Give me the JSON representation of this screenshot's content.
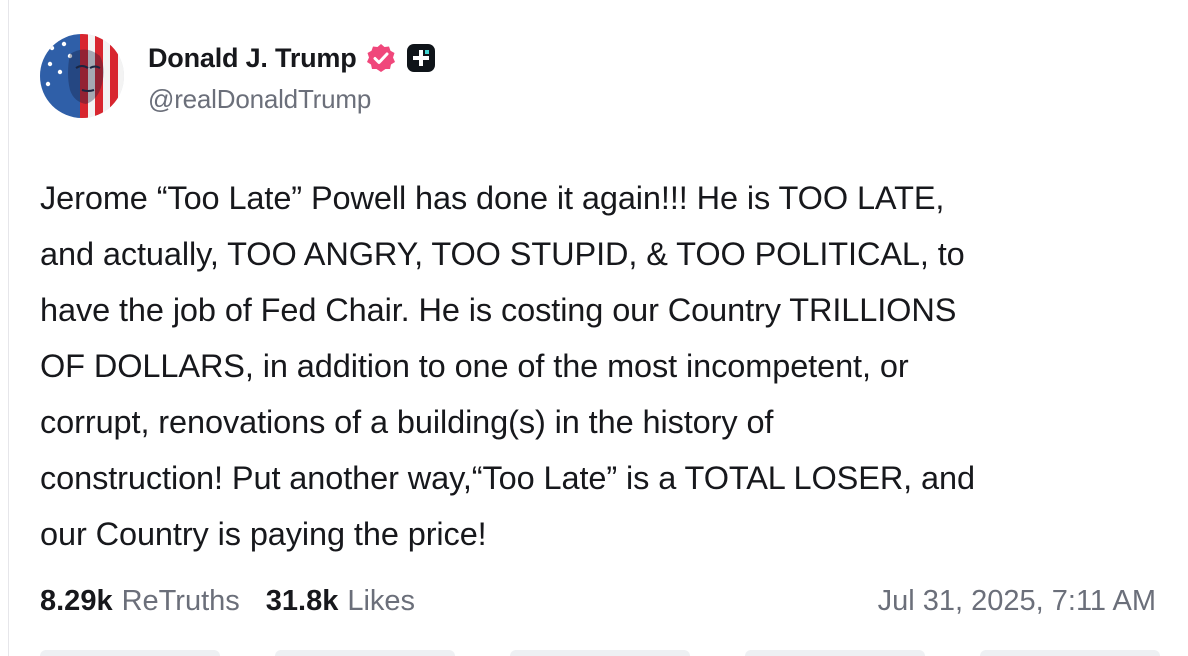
{
  "post": {
    "author": {
      "display_name": "Donald J. Trump",
      "handle": "@realDonaldTrump",
      "verified_icon": "verified-badge-icon",
      "plus_icon": "truth-plus-icon"
    },
    "text": "Jerome “Too Late” Powell has done it again!!! He is TOO LATE,\nand actually, TOO ANGRY, TOO STUPID, & TOO POLITICAL, to\nhave the job of Fed Chair. He is costing our Country TRILLIONS\nOF DOLLARS, in addition to one of the most incompetent, or\ncorrupt, renovations of a building(s) in the history of\nconstruction! Put another way,“Too Late” is a TOTAL LOSER, and\nour Country is paying the price!",
    "stats": {
      "retruths_count": "8.29k",
      "retruths_label": "ReTruths",
      "likes_count": "31.8k",
      "likes_label": "Likes"
    },
    "timestamp": "Jul 31, 2025, 7:11 AM"
  },
  "colors": {
    "verified_badge": "#f0477b",
    "plus_badge": "#0f1419",
    "text_primary": "#17181c",
    "text_secondary": "#6b6f7a"
  }
}
